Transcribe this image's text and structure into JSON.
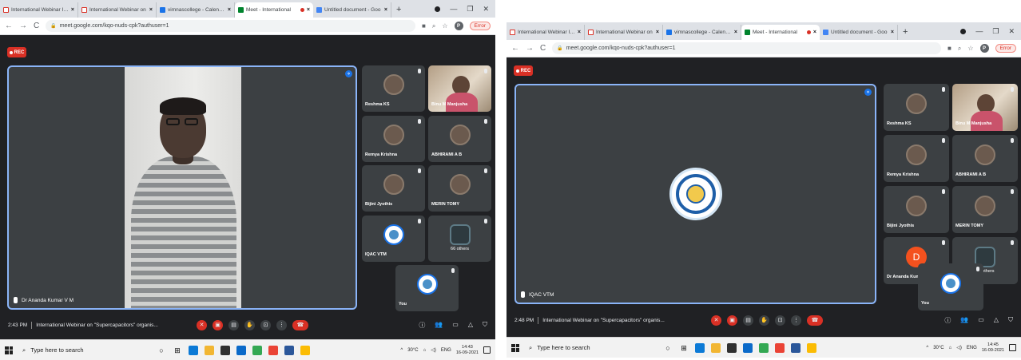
{
  "screens": [
    {
      "tabs": [
        {
          "label": "International Webinar Invi",
          "favicon": "gmail-icon"
        },
        {
          "label": "International Webinar on",
          "favicon": "gmail-icon"
        },
        {
          "label": "vimnascollege - Calendar",
          "favicon": "calendar-icon"
        },
        {
          "label": "Meet - International",
          "favicon": "meet-icon",
          "active": true
        },
        {
          "label": "Untitled document - Goo",
          "favicon": "docs-icon"
        }
      ],
      "url": "meet.google.com/kqo-nuds-cpk?authuser=1",
      "profile_initial": "P",
      "error_label": "Error",
      "rec_label": "REC",
      "main_name": "Dr Ananda Kumar V M",
      "main_content": "speaker-video",
      "tiles": [
        {
          "name": "Reshma KS",
          "kind": "photo"
        },
        {
          "name": "Binu M Manjusha",
          "kind": "video"
        },
        {
          "name": "Remya Krishna",
          "kind": "photo"
        },
        {
          "name": "ABHIRAMI A B",
          "kind": "photo"
        },
        {
          "name": "Bijini Jyothis",
          "kind": "photo"
        },
        {
          "name": "MERIN TOMY",
          "kind": "photo"
        },
        {
          "name": "IQAC VTM",
          "kind": "logo"
        },
        {
          "name": "",
          "kind": "group",
          "others": "66 others"
        },
        {
          "name": "You",
          "kind": "logo"
        }
      ],
      "time": "2:43 PM",
      "meeting_title": "International Webinar on \"Supercapacitors\" organis...",
      "search_placeholder": "Type here to search",
      "weather": "30°C",
      "lang": "ENG",
      "clock_time": "14:43",
      "clock_date": "16-09-2021"
    },
    {
      "tabs": [
        {
          "label": "International Webinar Invi",
          "favicon": "gmail-icon"
        },
        {
          "label": "International Webinar on",
          "favicon": "gmail-icon"
        },
        {
          "label": "vimnascollege - Calendar",
          "favicon": "calendar-icon"
        },
        {
          "label": "Meet - International",
          "favicon": "meet-icon",
          "active": true
        },
        {
          "label": "Untitled document - Goo",
          "favicon": "docs-icon"
        }
      ],
      "url": "meet.google.com/kqo-nuds-cpk?authuser=1",
      "profile_initial": "P",
      "error_label": "Error",
      "rec_label": "REC",
      "main_name": "IQAC VTM",
      "main_content": "logo",
      "tiles": [
        {
          "name": "Reshma KS",
          "kind": "photo"
        },
        {
          "name": "Binu M Manjusha",
          "kind": "video"
        },
        {
          "name": "Remya Krishna",
          "kind": "photo"
        },
        {
          "name": "ABHIRAMI A B",
          "kind": "photo"
        },
        {
          "name": "Bijini Jyothis",
          "kind": "photo"
        },
        {
          "name": "MERIN TOMY",
          "kind": "photo"
        },
        {
          "name": "Dr Ananda Kumar V M",
          "kind": "letter",
          "letter": "D"
        },
        {
          "name": "",
          "kind": "group",
          "others": "67 others"
        },
        {
          "name": "You",
          "kind": "logo"
        }
      ],
      "time": "2:48 PM",
      "meeting_title": "International Webinar on \"Supercapacitors\" organis...",
      "search_placeholder": "Type here to search",
      "weather": "30°C",
      "lang": "ENG",
      "clock_time": "14:45",
      "clock_date": "16-09-2021"
    }
  ]
}
